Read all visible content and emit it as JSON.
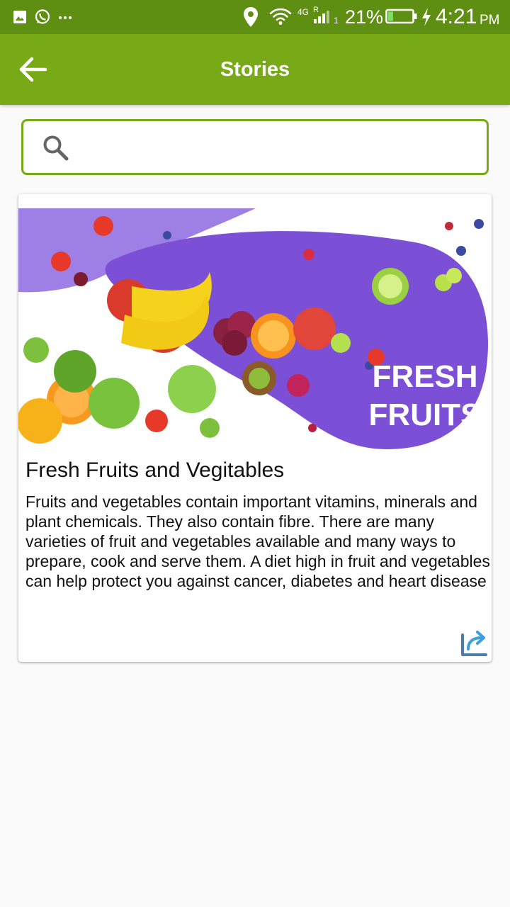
{
  "status_bar": {
    "network": "4G",
    "roaming": "R",
    "sim": "1",
    "battery": "21%",
    "battery_level": 0.21,
    "time": "4:21",
    "ampm": "PM",
    "icons": [
      "image-icon",
      "whatsapp-icon",
      "more-notifications-icon",
      "location-icon",
      "wifi-icon",
      "signal-icon",
      "battery-icon",
      "charging-icon"
    ]
  },
  "app_bar": {
    "title": "Stories",
    "back_icon": "arrow-left-icon",
    "color": "#77aa16"
  },
  "search": {
    "placeholder": "",
    "value": "",
    "icon": "search-icon"
  },
  "story": {
    "image_text_line1": "FRESH",
    "image_text_line2": "FRUITS",
    "title": "Fresh Fruits and Vegitables",
    "body": "Fruits and vegetables contain important vitamins, minerals and plant chemicals. They also contain fibre. There are many varieties of fruit and vegetables available and many ways to prepare, cook and serve them. A diet high in fruit and vegetables can help protect you against cancer, diabetes and heart disease",
    "share_icon": "share-icon",
    "accent": "#7b4fd6"
  }
}
